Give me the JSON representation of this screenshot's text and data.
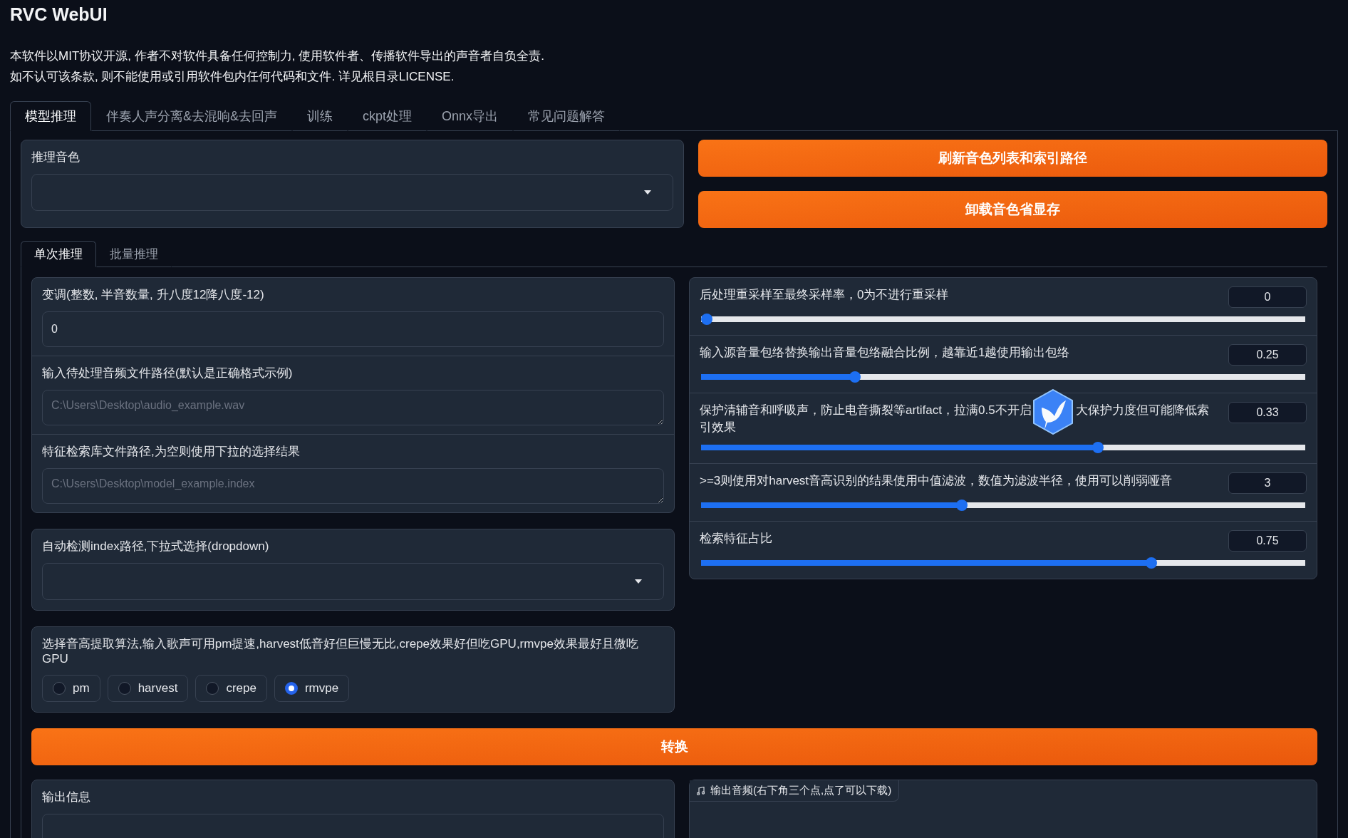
{
  "title": "RVC WebUI",
  "notice": [
    "本软件以MIT协议开源, 作者不对软件具备任何控制力, 使用软件者、传播软件导出的声音者自负全责.",
    "如不认可该条款, 则不能使用或引用软件包内任何代码和文件. 详见根目录LICENSE."
  ],
  "tabs": [
    {
      "label": "模型推理",
      "selected": true
    },
    {
      "label": "伴奏人声分离&去混响&去回声",
      "selected": false
    },
    {
      "label": "训练",
      "selected": false
    },
    {
      "label": "ckpt处理",
      "selected": false
    },
    {
      "label": "Onnx导出",
      "selected": false
    },
    {
      "label": "常见问题解答",
      "selected": false
    }
  ],
  "voice": {
    "label": "推理音色"
  },
  "top_buttons": [
    "刷新音色列表和索引路径",
    "卸载音色省显存"
  ],
  "subtabs": [
    {
      "label": "单次推理",
      "selected": true
    },
    {
      "label": "批量推理",
      "selected": false
    }
  ],
  "fields": [
    {
      "kind": "text",
      "label": "变调(整数, 半音数量, 升八度12降八度-12)",
      "value": "0"
    },
    {
      "kind": "textarea",
      "label": "输入待处理音频文件路径(默认是正确格式示例)",
      "placeholder": "C:\\Users\\Desktop\\audio_example.wav"
    },
    {
      "kind": "textarea",
      "label": "特征检索库文件路径,为空则使用下拉的选择结果",
      "placeholder": "C:\\Users\\Desktop\\model_example.index"
    }
  ],
  "index_dropdown": {
    "label": "自动检测index路径,下拉式选择(dropdown)"
  },
  "f0_method": {
    "label": "选择音高提取算法,输入歌声可用pm提速,harvest低音好但巨慢无比,crepe效果好但吃GPU,rmvpe效果最好且微吃GPU",
    "options": [
      {
        "label": "pm",
        "selected": false
      },
      {
        "label": "harvest",
        "selected": false
      },
      {
        "label": "crepe",
        "selected": false
      },
      {
        "label": "rmvpe",
        "selected": true
      }
    ]
  },
  "sliders": [
    {
      "label_parts": [
        "后处理重采样至最终采样率，0为不进行重采样"
      ],
      "value": "0",
      "level": 0
    },
    {
      "label_parts": [
        "输入源音量包络替换输出音量包络融合比例，越靠近1越使用输出包络"
      ],
      "value": "0.25",
      "level": 0.25
    },
    {
      "label_parts": [
        "保护清辅音和呼吸声，防止电音撕裂等artifact，拉满0.5不开启",
        "大保护力度但可能降低索",
        "引效果"
      ],
      "value": "0.33",
      "level": 0.66
    },
    {
      "label_parts": [
        ">=3则使用对harvest音高识别的结果使用中值滤波，数值为滤波半径，使用可以削弱哑音"
      ],
      "value": "3",
      "level": 0.43
    },
    {
      "label_parts": [
        "检索特征占比"
      ],
      "value": "0.75",
      "level": 0.75
    }
  ],
  "convert_button": "转换",
  "output_info": {
    "label": "输出信息"
  },
  "output_audio": {
    "label": "输出音频(右下角三个点,点了可以下载)"
  }
}
